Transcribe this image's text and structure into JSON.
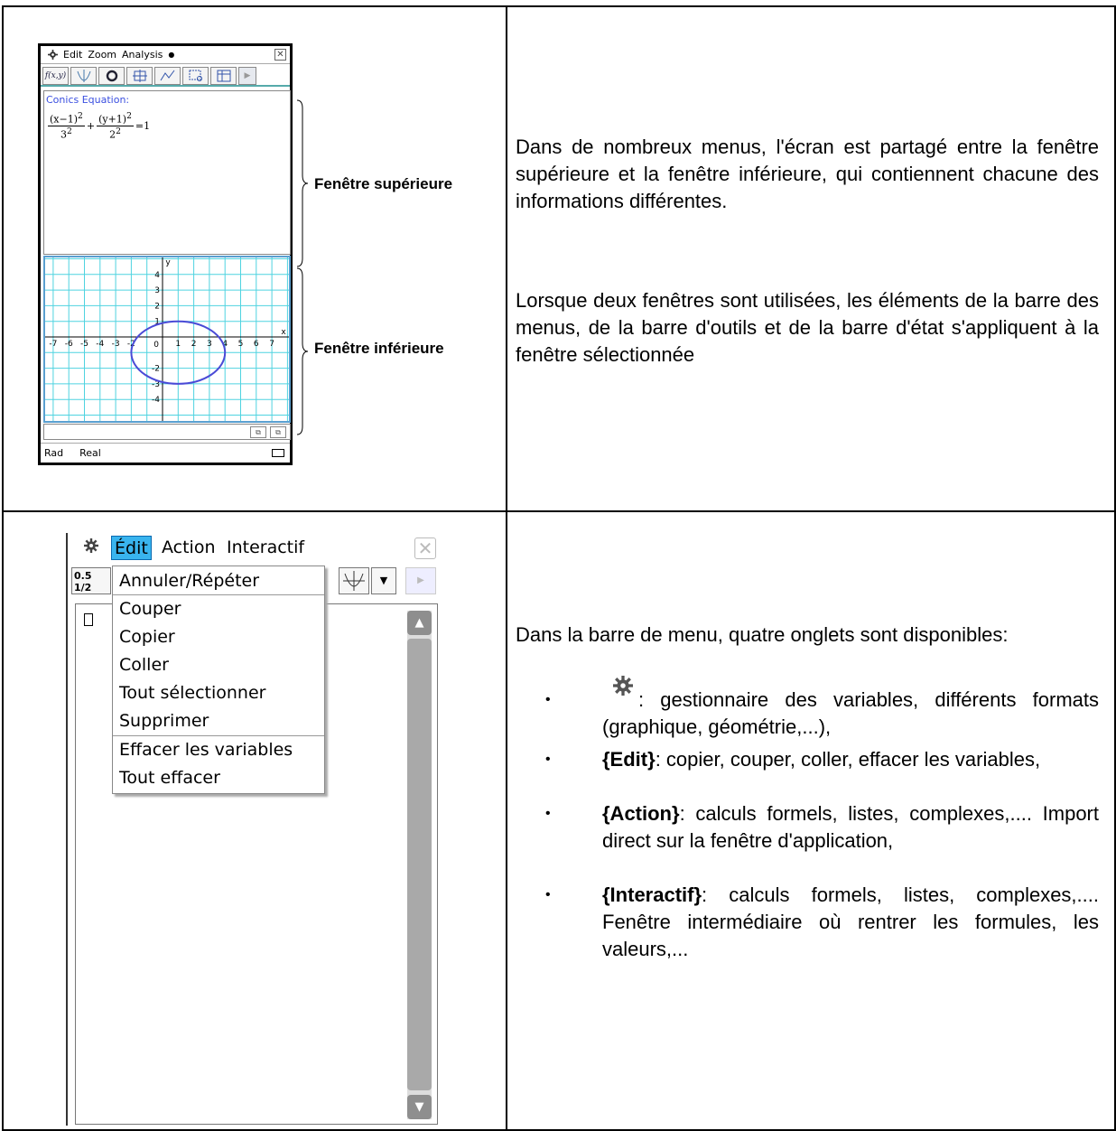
{
  "calc1": {
    "menu": [
      "Edit",
      "Zoom",
      "Analysis"
    ],
    "menu_dot": "●",
    "close": "✕",
    "toolbar_first": "f(x,y)",
    "conics_title": "Conics Equation:",
    "equation": {
      "term1_num": "(x−1)",
      "term1_num_exp": "2",
      "term1_den": "3",
      "term1_den_exp": "2",
      "plus": "+",
      "term2_num": "(y+1)",
      "term2_num_exp": "2",
      "term2_den": "2",
      "term2_den_exp": "2",
      "rhs": "=1"
    },
    "graph": {
      "x_label": "x",
      "y_label": "y",
      "origin": "0",
      "x_ticks_neg": [
        "-7",
        "-6",
        "-5",
        "-4",
        "-3",
        "-2"
      ],
      "x_ticks_pos": [
        "1",
        "2",
        "3",
        "4",
        "5",
        "6",
        "7"
      ],
      "y_ticks_pos": [
        "4",
        "3",
        "2",
        "1"
      ],
      "y_ticks_neg": [
        "-2",
        "-3",
        "-4"
      ],
      "ellipse": {
        "cx": 1,
        "cy": -1,
        "rx": 3,
        "ry": 2,
        "color": "#4a4ad6"
      },
      "grid_color": "#4fd3e0"
    },
    "status": [
      "Rad",
      "Real"
    ],
    "label_upper": "Fenêtre supérieure",
    "label_lower": "Fenêtre inférieure"
  },
  "right_top": {
    "para1": "Dans de nombreux menus, l'écran est partagé entre la fenêtre supérieure et la fenêtre inférieure, qui contiennent chacune des informations différentes.",
    "para2": "Lorsque deux fenêtres sont utilisées, les éléments de la barre des menus, de la barre d'outils et de la barre d'état s'appliquent à la fenêtre sélectionnée"
  },
  "calc2": {
    "menu_edit": "Édit",
    "menu_action": "Action",
    "menu_interactif": "Interactif",
    "close": "✕",
    "toolbar_icon_label": "0.5 1/2",
    "toolbar_dropdown": "▼",
    "toolbar_arrow": "▶",
    "dropdown_items": [
      "Annuler/Répéter",
      "Couper",
      "Copier",
      "Coller",
      "Tout sélectionner",
      "Supprimer",
      "Effacer les variables",
      "Tout effacer"
    ],
    "scroll_up": "▲",
    "scroll_down": "▼"
  },
  "right_bottom": {
    "intro": "Dans la barre de menu, quatre onglets sont disponibles:",
    "bullet_symbol": "•",
    "b1_text": ": gestionnaire des variables, différents formats (graphique, géométrie,...),",
    "b2_bold": "{Edit}",
    "b2_text": ": copier, couper, coller, effacer les variables,",
    "b3_bold": "{Action}",
    "b3_text": ": calculs formels, listes, complexes,.... Import direct sur la fenêtre d'application,",
    "b4_bold": "{Interactif}",
    "b4_text": ": calculs formels, listes, complexes,.... Fenêtre intermédiaire où rentrer les formules, les valeurs,..."
  }
}
